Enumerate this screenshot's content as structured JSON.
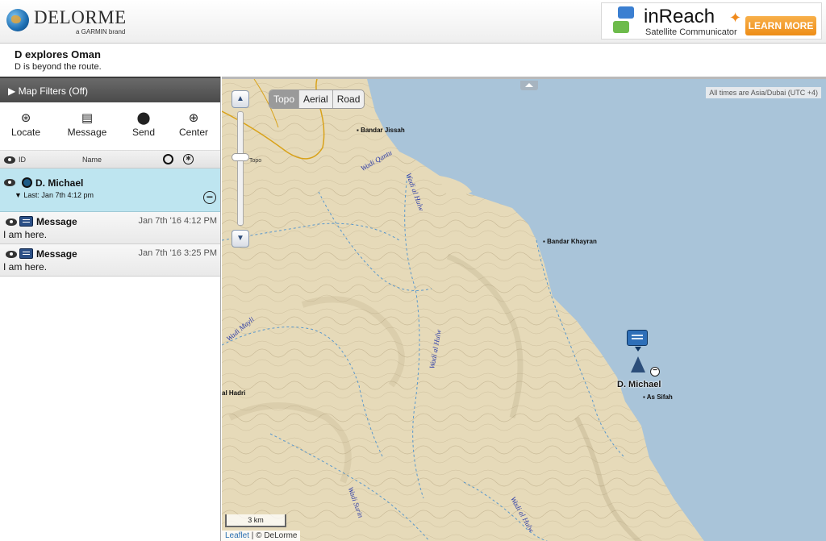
{
  "header": {
    "logo_text": "DELORME",
    "logo_sub": "a GARMIN brand",
    "ad": {
      "title": "inReach",
      "subtitle": "Satellite Communicator",
      "button": "LEARN MORE",
      "accent": "#ee8d17"
    }
  },
  "trip": {
    "title": "D explores Oman",
    "subtitle": "D is beyond the route."
  },
  "sidebar": {
    "filters_label": "▶ Map Filters (Off)",
    "tools": [
      {
        "label": "Locate",
        "icon": "locate-icon"
      },
      {
        "label": "Message",
        "icon": "message-icon"
      },
      {
        "label": "Send",
        "icon": "pin-icon"
      },
      {
        "label": "Center",
        "icon": "crosshair-icon"
      }
    ],
    "columns": {
      "id": "ID",
      "name": "Name"
    },
    "device": {
      "name": "D. Michael",
      "last": "Last: Jan 7th 4:12 pm",
      "color": "#bee5f0"
    },
    "messages": [
      {
        "label": "Message",
        "time": "Jan 7th '16 4:12 PM",
        "text": "I am here."
      },
      {
        "label": "Message",
        "time": "Jan 7th '16 3:25 PM",
        "text": "I am here."
      }
    ]
  },
  "map": {
    "layers": [
      "Topo",
      "Aerial",
      "Road"
    ],
    "active_layer": "Topo",
    "zoom_label": "Topo",
    "timezone": "All times are Asia/Dubai (UTC +4)",
    "scale": "3 km",
    "attribution_link": "Leaflet",
    "attribution_rest": " | © DeLorme",
    "places": [
      "Bandar Jissah",
      "Bandar Khayran",
      "As Sifah",
      "al Hadri"
    ],
    "wadis": [
      "Wadi Qantu",
      "Wadi al Hulw",
      "Wadi Mayli",
      "Wadi al Hulw",
      "Wadi Surin",
      "Wadi al Hulw"
    ],
    "marker_label": "D. Michael",
    "colors": {
      "sea": "#a9c4d9",
      "land": "#e8dcc0",
      "route": "#d9a21a"
    }
  }
}
